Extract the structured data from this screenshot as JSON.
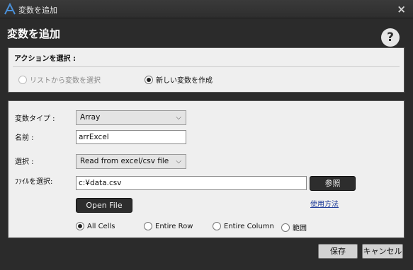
{
  "window": {
    "title": "変数を追加",
    "close_glyph": "×"
  },
  "header": {
    "title": "変数を追加",
    "help_glyph": "?"
  },
  "action": {
    "label": "アクションを選択 :",
    "options": [
      {
        "label": "リストから変数を選択",
        "checked": false,
        "disabled": true
      },
      {
        "label": "新しい変数を作成",
        "checked": true,
        "disabled": false
      }
    ]
  },
  "form": {
    "variable_type_label": "変数タイプ :",
    "variable_type_value": "Array",
    "name_label": "名前 :",
    "name_value": "arrExcel",
    "select_label": "選択 :",
    "select_value": "Read from excel/csv file",
    "file_label": "ﾌｧｲﾙを選択:",
    "file_value": "c:¥data.csv",
    "browse_label": "参照",
    "usage_link": "使用方法",
    "open_file_label": "Open File",
    "range_options": [
      {
        "label": "All Cells",
        "checked": true
      },
      {
        "label": "Entire Row",
        "checked": false
      },
      {
        "label": "Entire Column",
        "checked": false
      },
      {
        "label": "範囲",
        "checked": false
      }
    ]
  },
  "footer": {
    "save_label": "保存",
    "cancel_label": "キャンセル"
  },
  "colors": {
    "window_bg": "#2b2b2b",
    "panel_bg": "#efefef",
    "accent_logo": "#4a90d9"
  }
}
